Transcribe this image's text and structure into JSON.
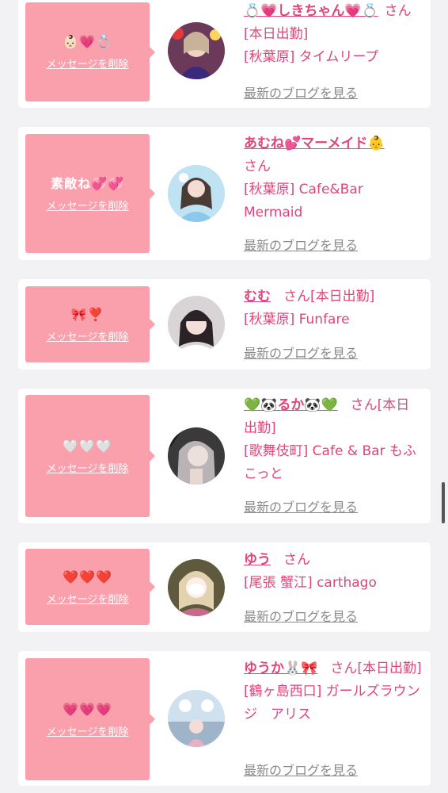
{
  "delete_label": "メッセージを削除",
  "blog_label": "最新のブログを見る",
  "entries": [
    {
      "message": "👶🏻💗💍",
      "name": "💍💗しきちゃん💗💍",
      "suffix": "さん[本日出勤]",
      "shop": "[秋葉原] タイムリープ"
    },
    {
      "message": "素敵ね💞💞",
      "name": "あむね💕マーメイド👶",
      "suffix": "さん",
      "shop": "[秋葉原] Cafe&Bar Mermaid"
    },
    {
      "message": "🎀❣️",
      "name": "むむ",
      "suffix": "さん[本日出勤]",
      "shop": "[秋葉原] Funfare"
    },
    {
      "message": "🤍🤍🤍",
      "name": "💚🐼るか🐼💚",
      "suffix": "さん[本日出勤]",
      "shop": "[歌舞伎町] Cafe & Bar もふこっと"
    },
    {
      "message": "❤️❤️❤️",
      "name": "ゆう",
      "suffix": "さん",
      "shop": "[尾張 蟹江] carthago"
    },
    {
      "message": "💗💗💗",
      "name": "ゆうか🐰🎀",
      "suffix": "さん[本日出勤]",
      "shop": "[鶴ヶ島西口] ガールズラウンジ　アリス"
    }
  ]
}
